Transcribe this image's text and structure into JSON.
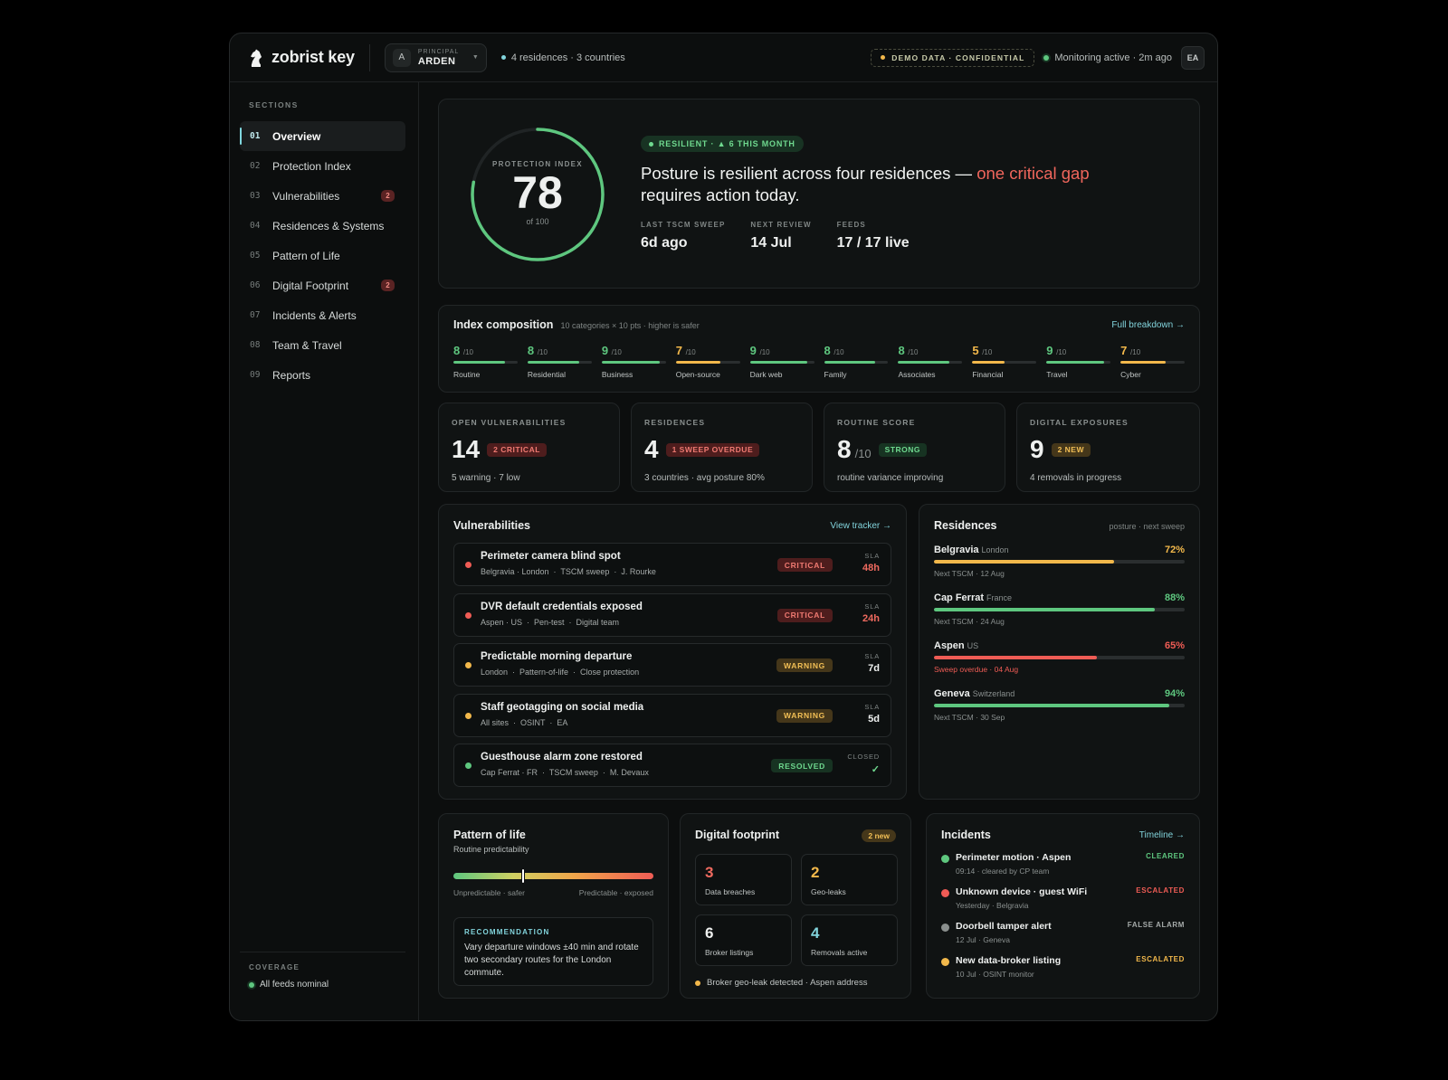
{
  "brand": {
    "name": "zobrist key"
  },
  "principal": {
    "initial": "A",
    "label": "PRINCIPAL",
    "name": "ARDEN"
  },
  "top_meta": "4 residences · 3 countries",
  "demo_label": "DEMO DATA · CONFIDENTIAL",
  "monitoring": "Monitoring active · 2m ago",
  "user_initials": "EA",
  "colors": {
    "green": "#5ec77f",
    "amber": "#f2b84b",
    "red": "#ef5c55",
    "accent": "#82d4dc",
    "grey": "#8a8f8e"
  },
  "sidebar": {
    "label": "SECTIONS",
    "items": [
      {
        "num": "01",
        "label": "Overview",
        "active": true
      },
      {
        "num": "02",
        "label": "Protection Index"
      },
      {
        "num": "03",
        "label": "Vulnerabilities",
        "badge": "2"
      },
      {
        "num": "04",
        "label": "Residences & Systems"
      },
      {
        "num": "05",
        "label": "Pattern of Life"
      },
      {
        "num": "06",
        "label": "Digital Footprint",
        "badge": "2"
      },
      {
        "num": "07",
        "label": "Incidents & Alerts"
      },
      {
        "num": "08",
        "label": "Team & Travel"
      },
      {
        "num": "09",
        "label": "Reports"
      }
    ],
    "coverage_label": "COVERAGE",
    "coverage_status": "All feeds nominal"
  },
  "hero": {
    "ring_label": "PROTECTION INDEX",
    "score": "78",
    "score_value": 78,
    "score_max": 100,
    "of_label": "of 100",
    "pill": "RESILIENT · ▲ 6 THIS MONTH",
    "headline_a": "Posture is resilient across four residences — ",
    "headline_crit": "one critical gap",
    "headline_b": " requires action today.",
    "stats": [
      {
        "label": "LAST TSCM SWEEP",
        "value": "6d ago"
      },
      {
        "label": "NEXT REVIEW",
        "value": "14 Jul"
      },
      {
        "label": "FEEDS",
        "value": "17 / 17 live"
      }
    ]
  },
  "composition": {
    "title": "Index composition",
    "subtitle": "10 categories × 10 pts · higher is safer",
    "link": "Full breakdown →",
    "unit": "/10",
    "items": [
      {
        "name": "Routine",
        "score": "8",
        "value": 8,
        "color": "#5ec77f"
      },
      {
        "name": "Residential",
        "score": "8",
        "value": 8,
        "color": "#5ec77f"
      },
      {
        "name": "Business",
        "score": "9",
        "value": 9,
        "color": "#5ec77f"
      },
      {
        "name": "Open-source",
        "score": "7",
        "value": 7,
        "color": "#f2b84b"
      },
      {
        "name": "Dark web",
        "score": "9",
        "value": 9,
        "color": "#5ec77f"
      },
      {
        "name": "Family",
        "score": "8",
        "value": 8,
        "color": "#5ec77f"
      },
      {
        "name": "Associates",
        "score": "8",
        "value": 8,
        "color": "#5ec77f"
      },
      {
        "name": "Financial",
        "score": "5",
        "value": 5,
        "color": "#f2b84b"
      },
      {
        "name": "Travel",
        "score": "9",
        "value": 9,
        "color": "#5ec77f"
      },
      {
        "name": "Cyber",
        "score": "7",
        "value": 7,
        "color": "#f2b84b"
      }
    ]
  },
  "kpis": [
    {
      "label": "OPEN VULNERABILITIES",
      "value": "14",
      "unit": "",
      "tag": "2 CRITICAL",
      "tag_color": "red",
      "sub": "5 warning · 7 low"
    },
    {
      "label": "RESIDENCES",
      "value": "4",
      "unit": "",
      "tag": "1 SWEEP OVERDUE",
      "tag_color": "red",
      "sub": "3 countries · avg posture 80%"
    },
    {
      "label": "ROUTINE SCORE",
      "value": "8",
      "unit": "/10",
      "tag": "STRONG",
      "tag_color": "green",
      "sub": "routine variance improving"
    },
    {
      "label": "DIGITAL EXPOSURES",
      "value": "9",
      "unit": "",
      "tag": "2 NEW",
      "tag_color": "amber",
      "sub": "4 removals in progress"
    }
  ],
  "vulnerabilities": {
    "title": "Vulnerabilities",
    "link": "View tracker →",
    "sla_label": "SLA",
    "items": [
      {
        "title": "Perimeter camera blind spot",
        "meta": "Belgravia · London  ·  TSCM sweep  ·  J. Rourke",
        "tag": "CRITICAL",
        "level": "red",
        "sla_label": "SLA",
        "sla": "48h"
      },
      {
        "title": "DVR default credentials exposed",
        "meta": "Aspen · US  ·  Pen-test  ·  Digital team",
        "tag": "CRITICAL",
        "level": "red",
        "sla_label": "SLA",
        "sla": "24h"
      },
      {
        "title": "Predictable morning departure",
        "meta": "London  ·  Pattern-of-life  ·  Close protection",
        "tag": "WARNING",
        "level": "amber",
        "sla_label": "SLA",
        "sla": "7d"
      },
      {
        "title": "Staff geotagging on social media",
        "meta": "All sites  ·  OSINT  ·  EA",
        "tag": "WARNING",
        "level": "amber",
        "sla_label": "SLA",
        "sla": "5d"
      },
      {
        "title": "Guesthouse alarm zone restored",
        "meta": "Cap Ferrat · FR  ·  TSCM sweep  ·  M. Devaux",
        "tag": "RESOLVED",
        "level": "green",
        "sla_label": "CLOSED",
        "sla": "✓"
      }
    ]
  },
  "residences": {
    "title": "Residences",
    "subtitle": "posture · next sweep",
    "items": [
      {
        "name": "Belgravia",
        "country": "London",
        "pct": "72%",
        "value": 72,
        "color": "#f2b84b",
        "next": "Next TSCM · 12 Aug",
        "next_color": "#8a908f"
      },
      {
        "name": "Cap Ferrat",
        "country": "France",
        "pct": "88%",
        "value": 88,
        "color": "#5ec77f",
        "next": "Next TSCM · 24 Aug",
        "next_color": "#8a908f"
      },
      {
        "name": "Aspen",
        "country": "US",
        "pct": "65%",
        "value": 65,
        "color": "#ef5c55",
        "next": "Sweep overdue · 04 Aug",
        "next_color": "#ef5c55"
      },
      {
        "name": "Geneva",
        "country": "Switzerland",
        "pct": "94%",
        "value": 94,
        "color": "#5ec77f",
        "next": "Next TSCM · 30 Sep",
        "next_color": "#8a908f"
      }
    ]
  },
  "pattern": {
    "title": "Pattern of life",
    "subtitle": "Routine predictability",
    "level": 0.35,
    "left_label": "Unpredictable · safer",
    "right_label": "Predictable · exposed",
    "rec_label": "RECOMMENDATION",
    "rec_text": "Vary departure windows ±40 min and rotate two secondary routes for the London commute."
  },
  "footprint": {
    "title": "Digital footprint",
    "badge": "2 new",
    "cells": [
      {
        "num": "3",
        "label": "Data breaches",
        "color": "#ef6a5f"
      },
      {
        "num": "2",
        "label": "Geo-leaks",
        "color": "#f2b84b"
      },
      {
        "num": "6",
        "label": "Broker listings",
        "color": "#eef0ef"
      },
      {
        "num": "4",
        "label": "Removals active",
        "color": "#82d4dc"
      }
    ],
    "footer": "Broker geo-leak detected · Aspen address"
  },
  "incidents": {
    "title": "Incidents",
    "link": "Timeline →",
    "items": [
      {
        "title": "Perimeter motion · Aspen",
        "meta": "09:14 · cleared by CP team",
        "status": "CLEARED",
        "color": "#5ec77f"
      },
      {
        "title": "Unknown device · guest WiFi",
        "meta": "Yesterday · Belgravia",
        "status": "ESCALATED",
        "color": "#ef5c55"
      },
      {
        "title": "Doorbell tamper alert",
        "meta": "12 Jul · Geneva",
        "status": "FALSE ALARM",
        "color": "#8a8f8e"
      },
      {
        "title": "New data-broker listing",
        "meta": "10 Jul · OSINT monitor",
        "status": "ESCALATED",
        "color": "#f2b84b"
      }
    ]
  }
}
